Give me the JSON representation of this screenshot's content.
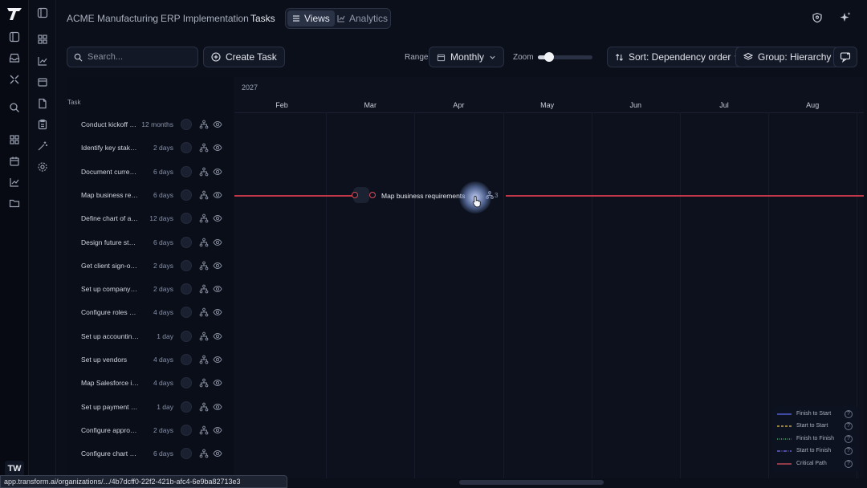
{
  "user": {
    "initials": "TW"
  },
  "breadcrumb": [
    "ACME Manufacturing",
    "ERP Implementation",
    "Tasks"
  ],
  "views": {
    "views_label": "Views",
    "analytics_label": "Analytics"
  },
  "toolbar": {
    "search_placeholder": "Search...",
    "create_label": "Create Task",
    "range_label": "Range",
    "range_value": "Monthly",
    "zoom_label": "Zoom",
    "zoom_level": 0.2,
    "sort_label": "Sort: Dependency order ↑",
    "group_label": "Group: Hierarchy"
  },
  "tasks_header": "Task",
  "tasks": [
    {
      "name": "Conduct kickoff meeting",
      "duration": "12 months"
    },
    {
      "name": "Identify key stakeholders",
      "duration": "2 days"
    },
    {
      "name": "Document current processes",
      "duration": "6 days"
    },
    {
      "name": "Map business requirements",
      "duration": "6 days"
    },
    {
      "name": "Define chart of accounts",
      "duration": "12 days"
    },
    {
      "name": "Design future state processes",
      "duration": "6 days"
    },
    {
      "name": "Get client sign-off on design",
      "duration": "2 days"
    },
    {
      "name": "Set up company information",
      "duration": "2 days"
    },
    {
      "name": "Configure roles and permissions",
      "duration": "4 days"
    },
    {
      "name": "Set up accounting periods",
      "duration": "1 day"
    },
    {
      "name": "Set up vendors",
      "duration": "4 days"
    },
    {
      "name": "Map Salesforce integration",
      "duration": "4 days"
    },
    {
      "name": "Set up payment terms",
      "duration": "1 day"
    },
    {
      "name": "Configure approval workflows",
      "duration": "2 days"
    },
    {
      "name": "Configure chart of accounts",
      "duration": "6 days"
    }
  ],
  "timeline": {
    "year": "2027",
    "months": [
      "Feb",
      "Mar",
      "Apr",
      "May",
      "Jun",
      "Jul",
      "Aug"
    ]
  },
  "gantt_bar": {
    "label": "Map business requirements",
    "dependency_count": "3"
  },
  "legend": [
    {
      "label": "Finish to Start",
      "color": "#5b6cf0",
      "style": "solid"
    },
    {
      "label": "Start to Start",
      "color": "#e6c14a",
      "style": "dashed"
    },
    {
      "label": "Finish to Finish",
      "color": "#4cc56a",
      "style": "dotted"
    },
    {
      "label": "Start to Finish",
      "color": "#7a6cf0",
      "style": "dashdot"
    },
    {
      "label": "Critical Path",
      "color": "#e0525f",
      "style": "solid"
    }
  ],
  "status_url": "app.transform.ai/organizations/.../4b7dcff0-22f2-421b-afc4-6e9ba82713e3"
}
